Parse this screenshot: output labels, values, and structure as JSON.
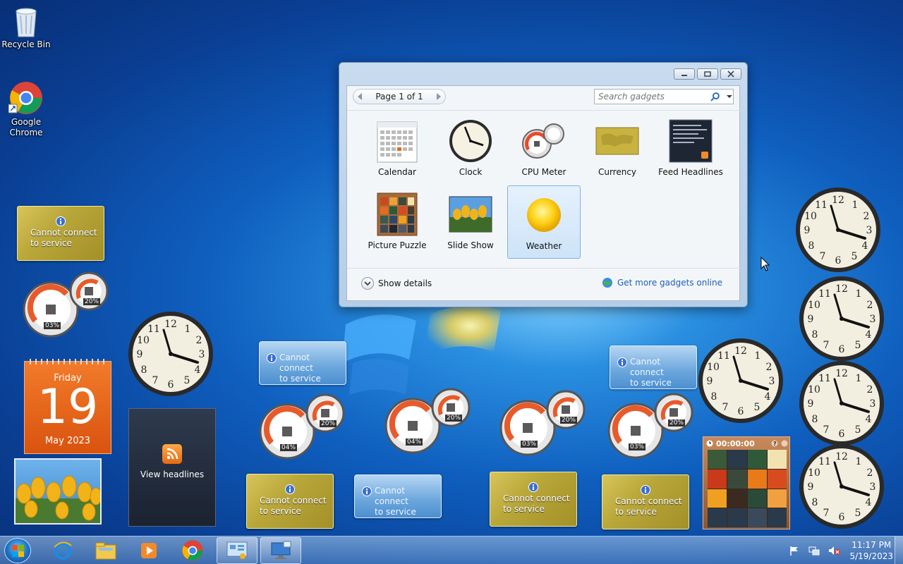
{
  "desktop": {
    "icons": [
      {
        "label": "Recycle Bin"
      },
      {
        "label": "Google Chrome"
      }
    ]
  },
  "gadget_window": {
    "pager_label": "Page 1 of 1",
    "search_placeholder": "Search gadgets",
    "gadgets": [
      {
        "label": "Calendar"
      },
      {
        "label": "Clock"
      },
      {
        "label": "CPU Meter"
      },
      {
        "label": "Currency"
      },
      {
        "label": "Feed Headlines"
      },
      {
        "label": "Picture Puzzle"
      },
      {
        "label": "Slide Show"
      },
      {
        "label": "Weather"
      }
    ],
    "selected": "Weather",
    "show_details": "Show details",
    "get_more": "Get more gadgets online"
  },
  "gadgets": {
    "service_error": "Cannot connect to service",
    "service_error_line1": "Cannot connect",
    "service_error_line2": "to service",
    "calendar": {
      "weekday": "Friday",
      "day": "19",
      "month_year": "May 2023"
    },
    "feed": {
      "label": "View headlines"
    },
    "puzzle": {
      "timer": "00:00:00"
    },
    "cpu_meters": [
      {
        "cpu": "03%",
        "mem": "20%"
      },
      {
        "cpu": "04%",
        "mem": "20%"
      },
      {
        "cpu": "04%",
        "mem": "20%"
      },
      {
        "cpu": "03%",
        "mem": "20%"
      },
      {
        "cpu": "03%",
        "mem": "20%"
      }
    ]
  },
  "taskbar": {
    "time": "11:17 PM",
    "date": "5/19/2023"
  },
  "colors": {
    "desktop_blue": "#0f5fbf",
    "link_blue": "#1e5fb4",
    "calendar_orange": "#e45f16"
  }
}
